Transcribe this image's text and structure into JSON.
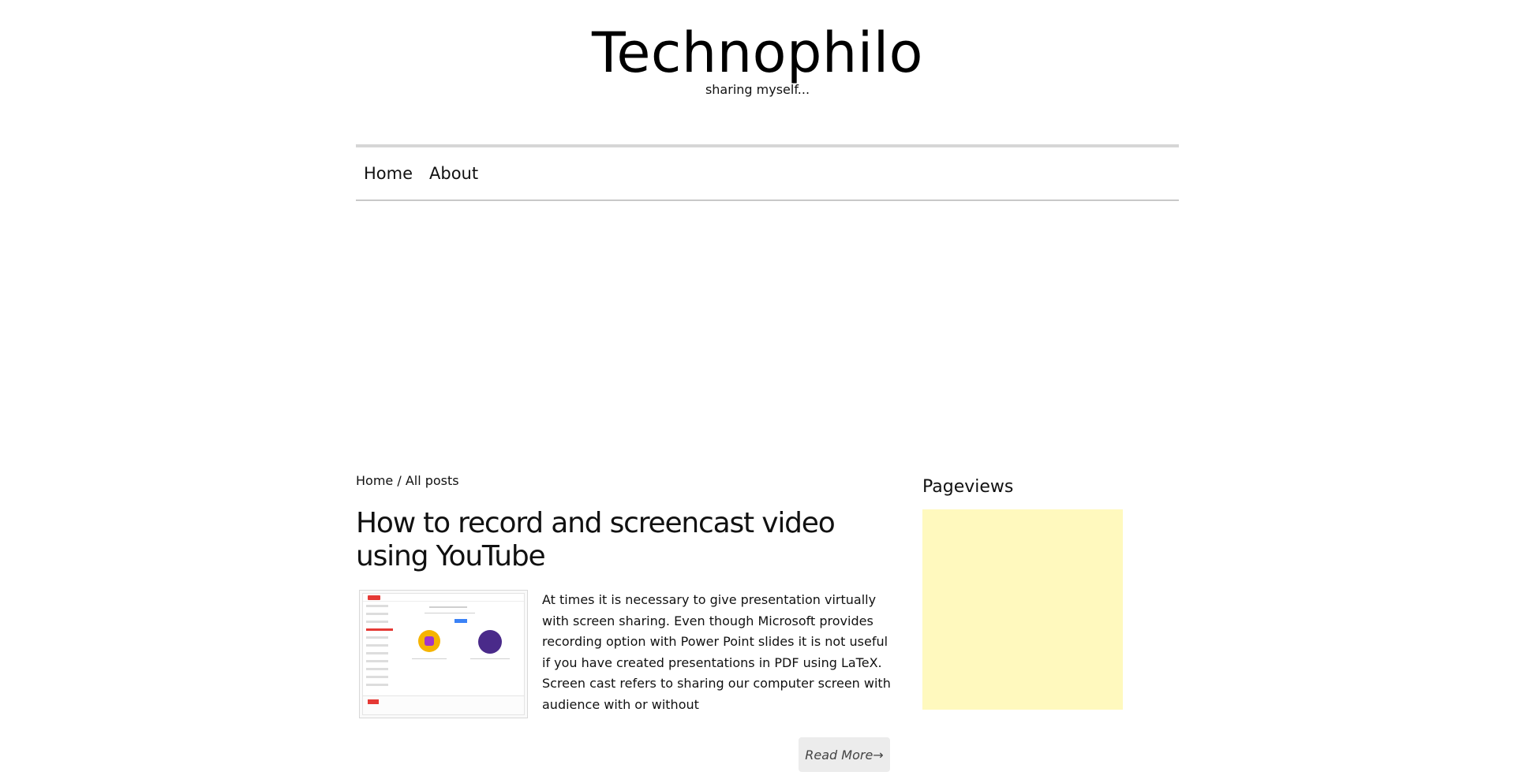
{
  "site": {
    "title": "Technophilo",
    "tagline": "sharing myself..."
  },
  "nav": {
    "items": [
      {
        "label": "Home"
      },
      {
        "label": "About"
      }
    ]
  },
  "breadcrumb": {
    "home": "Home",
    "separator": " / ",
    "current": "All posts"
  },
  "post": {
    "title": "How to record and screencast video using YouTube",
    "excerpt": "At times it is necessary to give presentation virtually with screen sharing. Even though Microsoft provides recording option with Power Point slides it is not useful if you have created presentations in PDF using LaTeX. Screen cast refers to sharing our computer screen with audience with or without",
    "read_more": "Read More→",
    "thumbnail_icon": "youtube-screenshot-thumbnail"
  },
  "sidebar": {
    "widget_title": "Pageviews",
    "widget_bg": "#fff9be"
  }
}
